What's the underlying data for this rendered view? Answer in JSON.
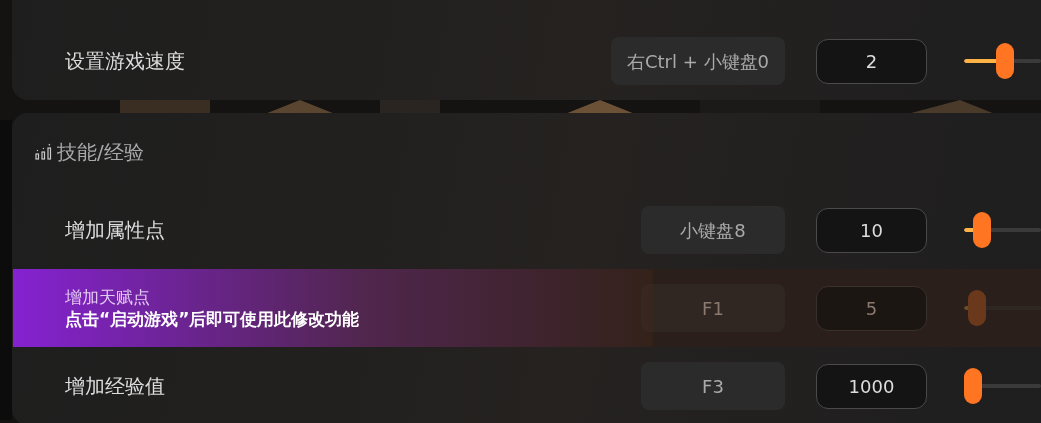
{
  "sections": [
    {
      "rows": [
        {
          "name": "设置游戏速度",
          "hotkey": "右Ctrl + 小键盘0",
          "value": "2",
          "disabled": false
        }
      ]
    },
    {
      "title": "技能/经验",
      "rows": [
        {
          "name": "增加属性点",
          "hotkey": "小键盘8",
          "value": "10",
          "disabled": false
        },
        {
          "name": "增加天赋点",
          "hotkey": "F1",
          "value": "5",
          "disabled": true,
          "notice": "点击“启动游戏”后即可使用此修改功能"
        },
        {
          "name": "增加经验值",
          "hotkey": "F3",
          "value": "1000",
          "disabled": false
        }
      ]
    }
  ]
}
